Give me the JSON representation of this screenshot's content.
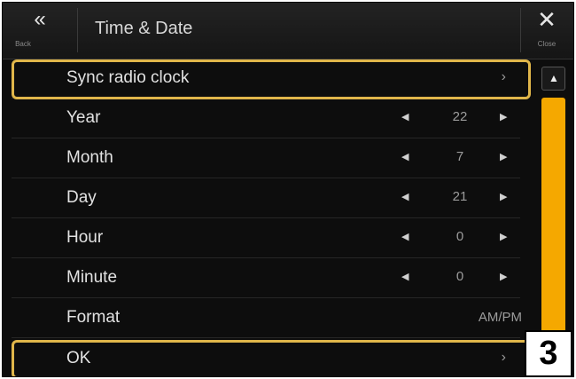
{
  "header": {
    "back_icon": "«",
    "back_label": "Back",
    "title": "Time & Date",
    "close_icon": "✕",
    "close_label": "Close"
  },
  "rows": [
    {
      "label": "Sync radio clock",
      "type": "link",
      "chevron": "›"
    },
    {
      "label": "Year",
      "type": "stepper",
      "value": "22"
    },
    {
      "label": "Month",
      "type": "stepper",
      "value": "7"
    },
    {
      "label": "Day",
      "type": "stepper",
      "value": "21"
    },
    {
      "label": "Hour",
      "type": "stepper",
      "value": "0"
    },
    {
      "label": "Minute",
      "type": "stepper",
      "value": "0"
    },
    {
      "label": "Format",
      "type": "value",
      "value": "AM/PM"
    },
    {
      "label": "OK",
      "type": "link",
      "chevron": "›"
    }
  ],
  "stepper": {
    "left_icon": "◀",
    "right_icon": "▶"
  },
  "scrollbar": {
    "up_icon": "▲"
  },
  "callout": {
    "step": "3"
  },
  "colors": {
    "highlight": "#e0b64a",
    "scroll_thumb": "#f5a800",
    "background": "#0d0d0d"
  }
}
